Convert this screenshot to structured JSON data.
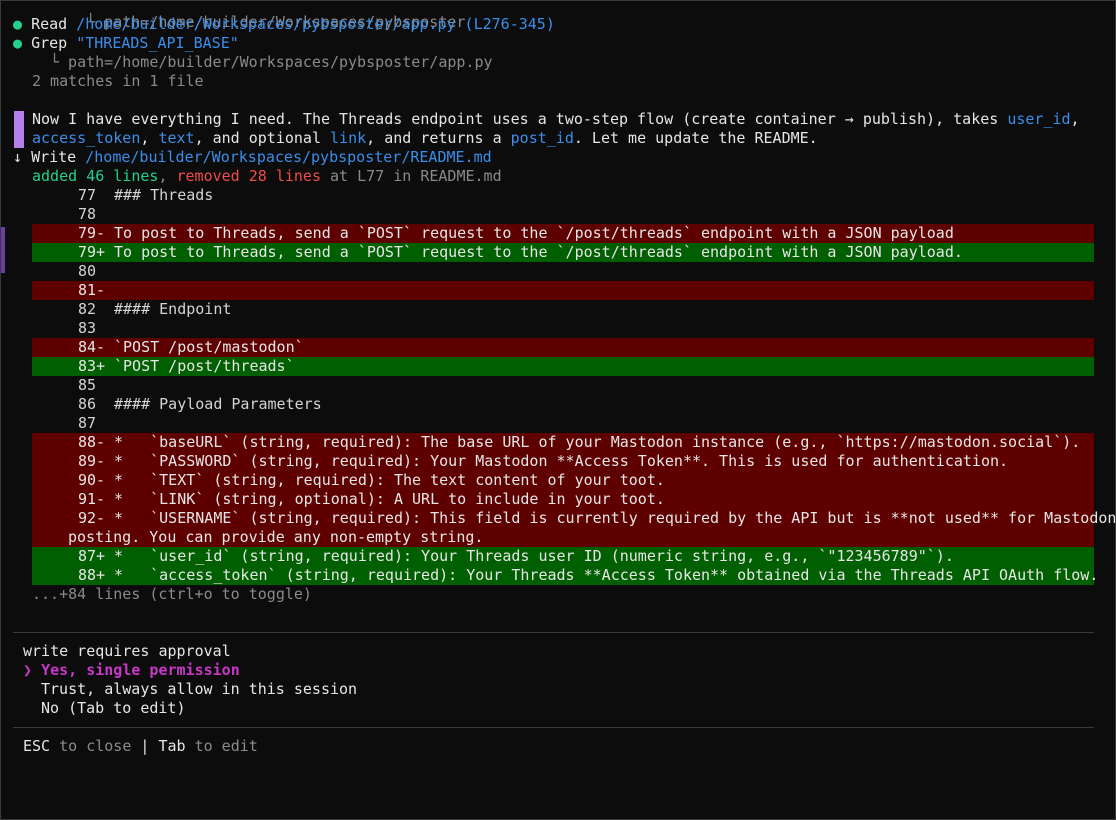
{
  "tool_log": {
    "top_path": "└ path=/home/builder/Workspaces/pybsposter",
    "read": {
      "tool": "Read",
      "path": "/home/builder/Workspaces/pybsposter/app.py",
      "range": "(L276-345)"
    },
    "grep": {
      "tool": "Grep",
      "pattern": "\"THREADS_API_BASE\"",
      "path": "└ path=/home/builder/Workspaces/pybsposter/app.py",
      "result": "2 matches in 1 file"
    }
  },
  "message": {
    "line1_a": "Now I have everything I need. The Threads endpoint uses a two-step flow (create container → publish), takes ",
    "user_id": "user_id",
    "line1_b": ",",
    "access_token": "access_token",
    "line2_a": ", ",
    "text": "text",
    "line2_b": ", and optional ",
    "link": "link",
    "line2_c": ", and returns a ",
    "post_id": "post_id",
    "line2_d": ". Let me update the README."
  },
  "write": {
    "arrow": "↓",
    "tool": "Write",
    "path": "/home/builder/Workspaces/pybsposter/README.md",
    "added_prefix": "added",
    "added_count": "46 lines",
    "comma": ",",
    "removed_prefix": "removed",
    "removed_count": "28 lines",
    "location": "at L77 in README.md"
  },
  "diff": [
    {
      "type": "ctx",
      "num": "77",
      "sign": "",
      "text": "### Threads"
    },
    {
      "type": "ctx",
      "num": "78",
      "sign": "",
      "text": ""
    },
    {
      "type": "del",
      "num": "79",
      "sign": "-",
      "text": "To post to Threads, send a `POST` request to the `/post/threads` endpoint with a JSON payload"
    },
    {
      "type": "add",
      "num": "79",
      "sign": "+",
      "text": "To post to Threads, send a `POST` request to the `/post/threads` endpoint with a JSON payload."
    },
    {
      "type": "ctx",
      "num": "80",
      "sign": "",
      "text": ""
    },
    {
      "type": "del",
      "num": "81",
      "sign": "-",
      "text": ""
    },
    {
      "type": "ctx",
      "num": "82",
      "sign": "",
      "text": "#### Endpoint"
    },
    {
      "type": "ctx",
      "num": "83",
      "sign": "",
      "text": ""
    },
    {
      "type": "del",
      "num": "84",
      "sign": "-",
      "text": "`POST /post/mastodon`"
    },
    {
      "type": "add",
      "num": "83",
      "sign": "+",
      "text": "`POST /post/threads`"
    },
    {
      "type": "ctx",
      "num": "85",
      "sign": "",
      "text": ""
    },
    {
      "type": "ctx",
      "num": "86",
      "sign": "",
      "text": "#### Payload Parameters"
    },
    {
      "type": "ctx",
      "num": "87",
      "sign": "",
      "text": ""
    },
    {
      "type": "del",
      "num": "88",
      "sign": "-",
      "text": "*   `baseURL` (string, required): The base URL of your Mastodon instance (e.g., `https://mastodon.social`)."
    },
    {
      "type": "del",
      "num": "89",
      "sign": "-",
      "text": "*   `PASSWORD` (string, required): Your Mastodon **Access Token**. This is used for authentication."
    },
    {
      "type": "del",
      "num": "90",
      "sign": "-",
      "text": "*   `TEXT` (string, required): The text content of your toot."
    },
    {
      "type": "del",
      "num": "91",
      "sign": "-",
      "text": "*   `LINK` (string, optional): A URL to include in your toot."
    },
    {
      "type": "del",
      "num": "92",
      "sign": "-",
      "text": "*   `USERNAME` (string, required): This field is currently required by the API but is **not used** for Mastodon"
    },
    {
      "type": "del",
      "num": "",
      "sign": "",
      "text": "posting. You can provide any non-empty string."
    },
    {
      "type": "add",
      "num": "87",
      "sign": "+",
      "text": "*   `user_id` (string, required): Your Threads user ID (numeric string, e.g., `\"123456789\"`)."
    },
    {
      "type": "add",
      "num": "88",
      "sign": "+",
      "text": "*   `access_token` (string, required): Your Threads **Access Token** obtained via the Threads API OAuth flow."
    }
  ],
  "more_lines": "...+84 lines (ctrl+o to toggle)",
  "approval": {
    "title": "write requires approval",
    "cursor": "❯",
    "options": [
      "Yes, single permission",
      "Trust, always allow in this session",
      "No (Tab to edit)"
    ]
  },
  "footer": {
    "esc_key": "ESC",
    "esc_label": "to close",
    "divider": "|",
    "tab_key": "Tab",
    "tab_label": "to edit"
  },
  "colors": {
    "background": "#0c0c0c",
    "deleted_row": "#5f0000",
    "added_row": "#005f00",
    "link_blue": "#3b8eea",
    "selected_option": "#c837c8"
  }
}
